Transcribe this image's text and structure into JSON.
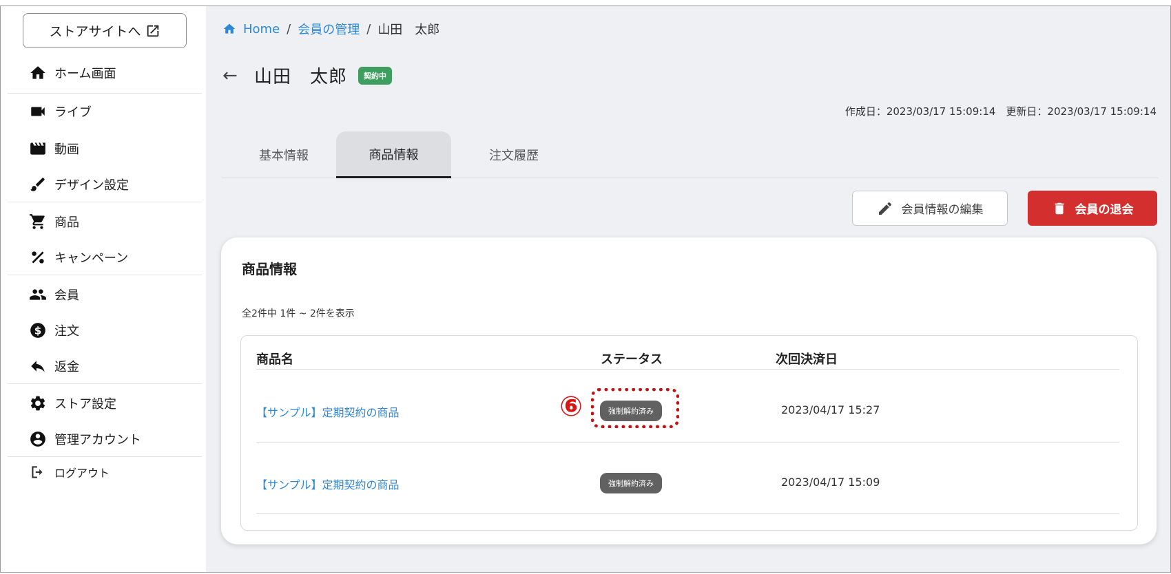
{
  "sidebar": {
    "store_link": "ストアサイトへ",
    "items": [
      {
        "label": "ホーム画面",
        "icon": "home-icon"
      },
      {
        "label": "ライブ",
        "icon": "videocam-icon"
      },
      {
        "label": "動画",
        "icon": "movie-icon"
      },
      {
        "label": "デザイン設定",
        "icon": "brush-icon"
      },
      {
        "label": "商品",
        "icon": "cart-icon"
      },
      {
        "label": "キャンペーン",
        "icon": "percent-icon"
      },
      {
        "label": "会員",
        "icon": "people-icon"
      },
      {
        "label": "注文",
        "icon": "dollar-icon"
      },
      {
        "label": "返金",
        "icon": "reply-icon"
      },
      {
        "label": "ストア設定",
        "icon": "gear-icon"
      },
      {
        "label": "管理アカウント",
        "icon": "account-icon"
      },
      {
        "label": "ログアウト",
        "icon": "logout-icon"
      }
    ]
  },
  "breadcrumb": {
    "home": "Home",
    "sep": "/",
    "members": "会員の管理",
    "current": "山田　太郎"
  },
  "header": {
    "title": "山田　太郎",
    "status": "契約中",
    "dates": "作成日：2023/03/17 15:09:14　更新日：2023/03/17 15:09:14"
  },
  "tabs": [
    {
      "label": "基本情報"
    },
    {
      "label": "商品情報"
    },
    {
      "label": "注文履歴"
    }
  ],
  "actions": {
    "edit": "会員情報の編集",
    "delete": "会員の退会"
  },
  "card": {
    "title": "商品情報",
    "count": "全2件中 1件 ~ 2件を表示",
    "columns": [
      "商品名",
      "ステータス",
      "次回決済日"
    ],
    "rows": [
      {
        "name": "【サンプル】定期契約の商品",
        "status": "強制解約済み",
        "next_date": "2023/04/17 15:27"
      },
      {
        "name": "【サンプル】定期契約の商品",
        "status": "強制解約済み",
        "next_date": "2023/04/17 15:09"
      }
    ]
  },
  "annotation": {
    "marker": "⑥"
  },
  "colors": {
    "link": "#2f88d5",
    "status_active": "#3e9e5f",
    "danger": "#d32f2f",
    "chip": "#616161",
    "annotation": "#c01515"
  }
}
